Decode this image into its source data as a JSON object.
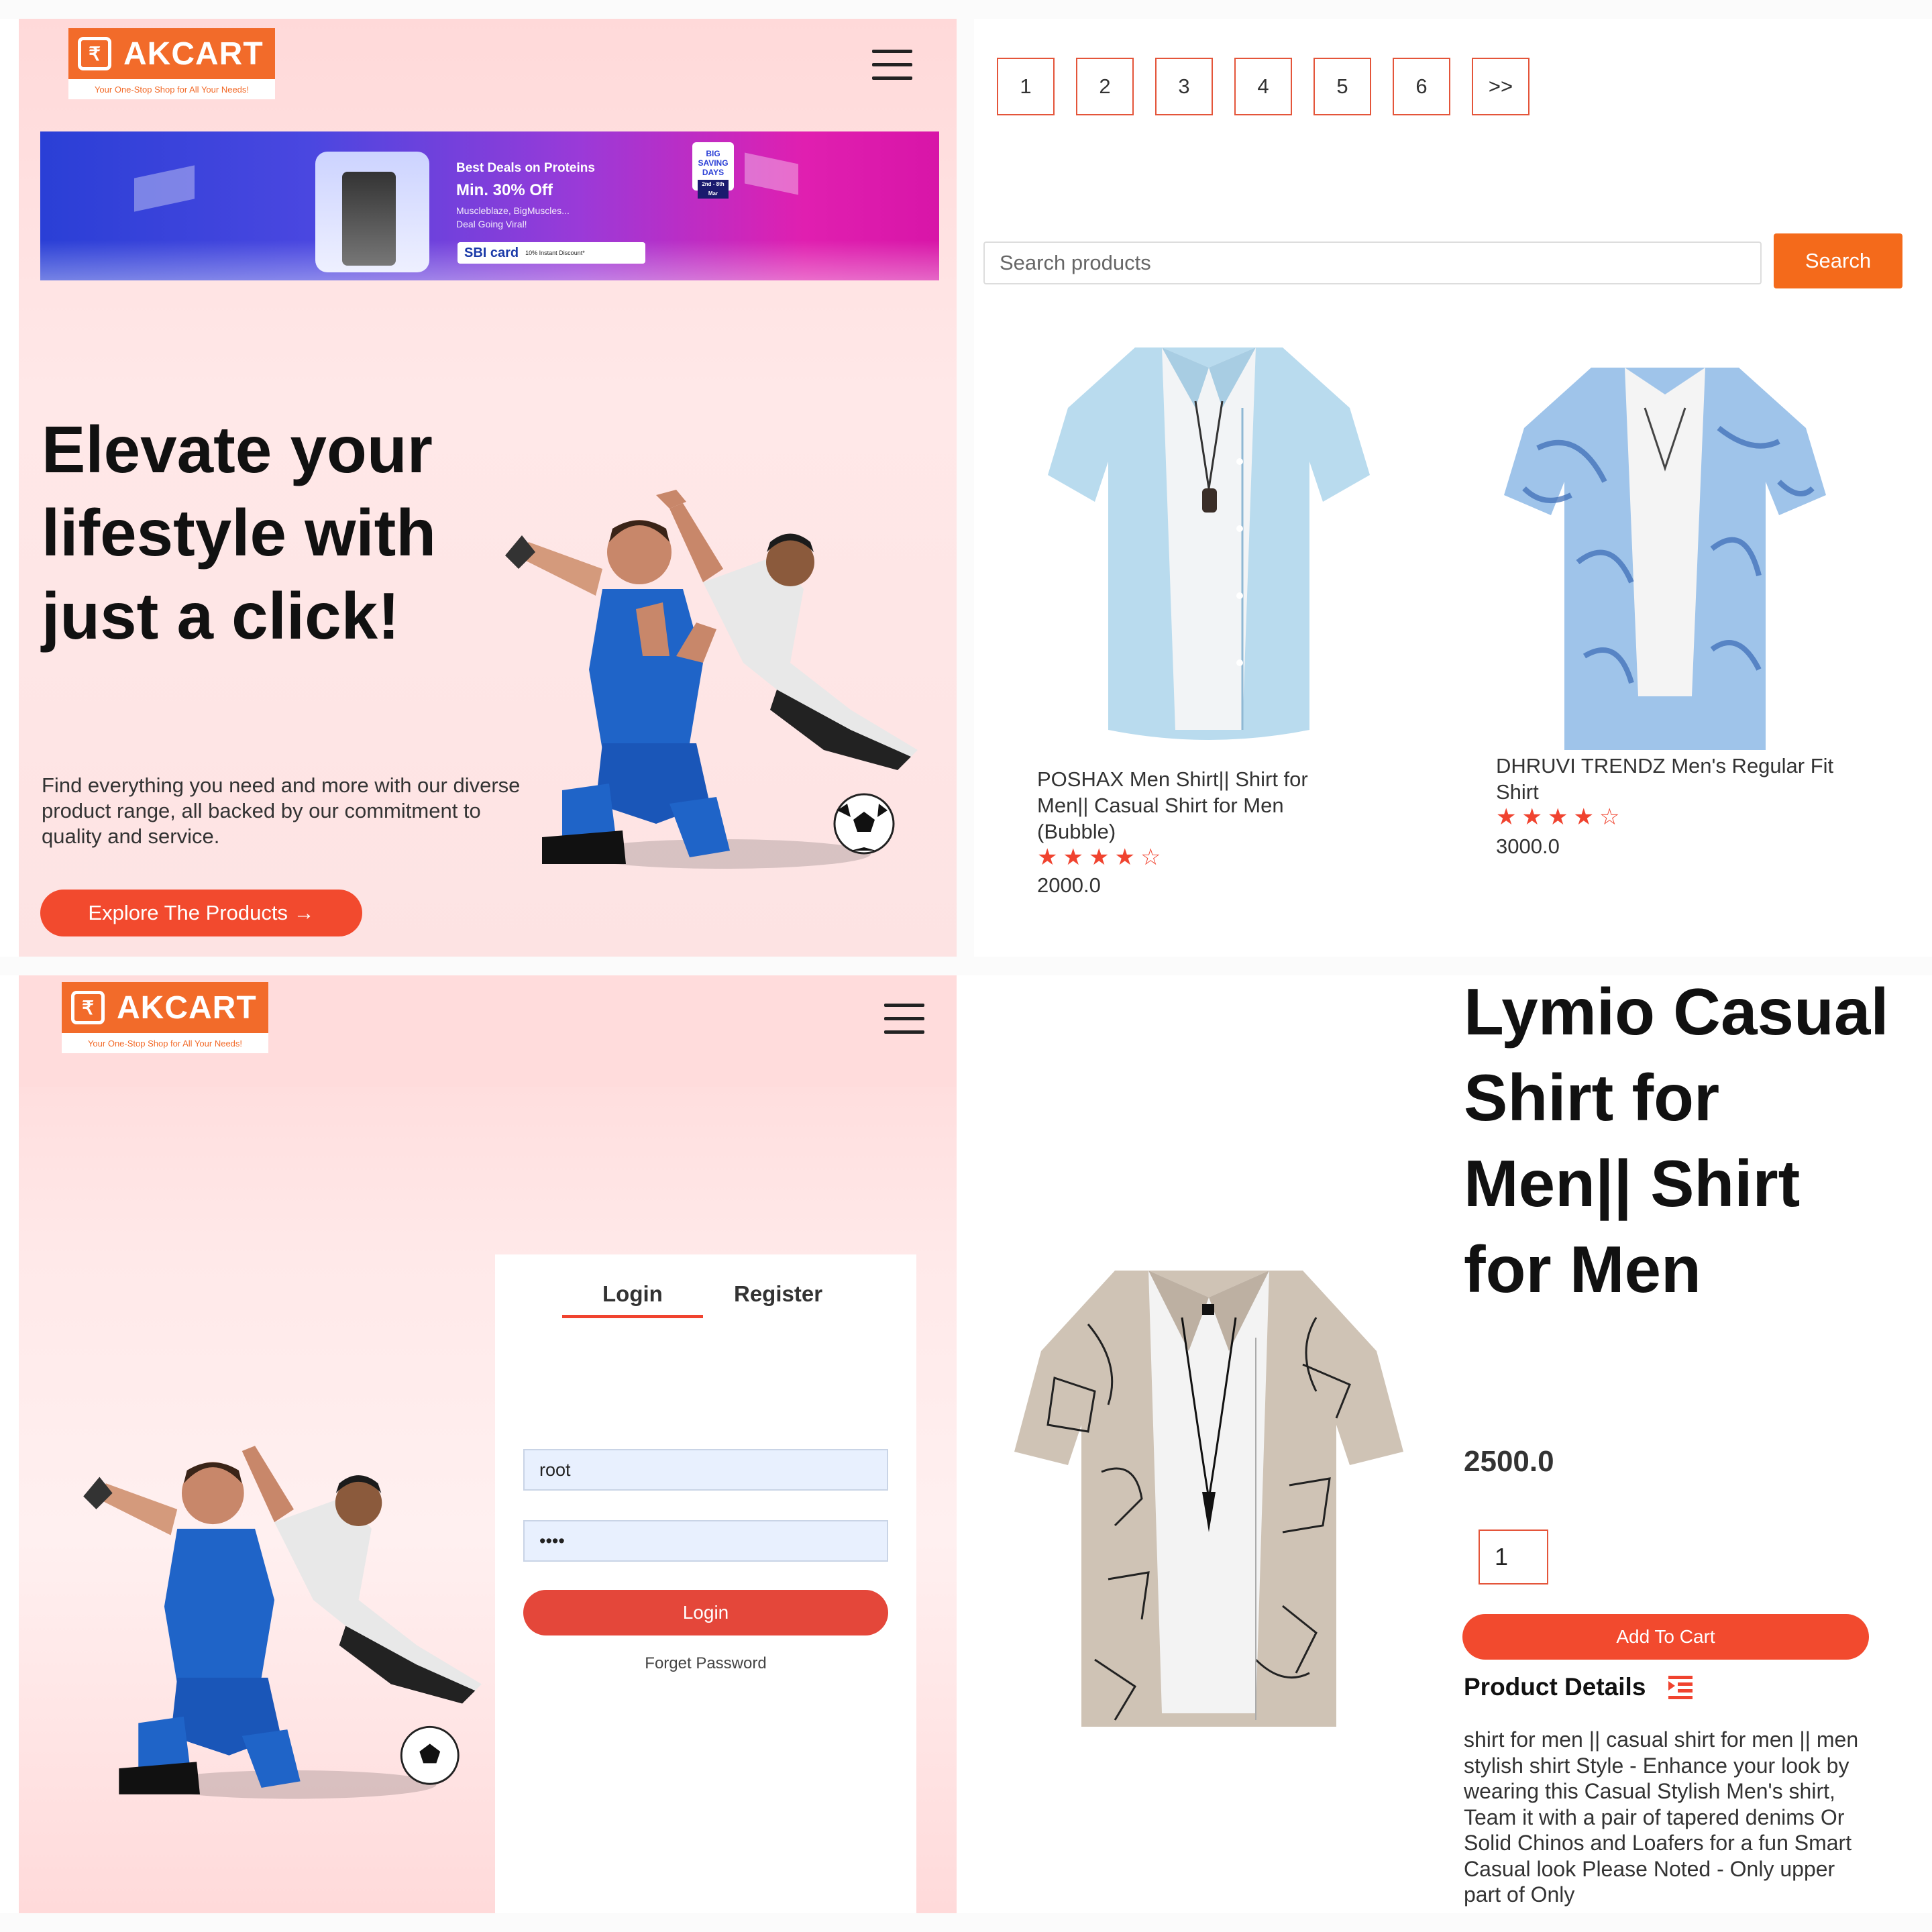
{
  "brand": {
    "name": "AKCART",
    "tagline": "Your One-Stop Shop for All Your Needs!",
    "color": "#f26b2a",
    "accent": "#f24a2e"
  },
  "home": {
    "banner": {
      "line1": "Best Deals on Proteins",
      "line2": "Min. 30% Off",
      "line3": "Muscleblaze, BigMuscles...",
      "line4": "Deal Going Viral!",
      "card_name": "SBI card",
      "card_offer": "10% Instant Discount*",
      "badge": "BIG SAVING DAYS",
      "badge_sub": "2nd - 8th Mar"
    },
    "hero_title": "Elevate your lifestyle with just a click!",
    "hero_desc": "Find everything you need and more with our diverse product range, all backed by our commitment to quality and service.",
    "cta": "Explore The Products →"
  },
  "listing": {
    "pages": [
      "1",
      "2",
      "3",
      "4",
      "5",
      "6",
      ">>"
    ],
    "search_placeholder": "Search products",
    "search_button": "Search",
    "products": [
      {
        "name": "POSHAX Men Shirt|| Shirt for Men|| Casual Shirt for Men (Bubble)",
        "rating": 4,
        "price": "2000.0",
        "stars": [
          "★",
          "★",
          "★",
          "★",
          "☆"
        ]
      },
      {
        "name": "DHRUVI TRENDZ Men's Regular Fit Shirt",
        "rating": 4,
        "price": "3000.0",
        "stars": [
          "★",
          "★",
          "★",
          "★",
          "☆"
        ]
      }
    ]
  },
  "auth": {
    "tab_login": "Login",
    "tab_register": "Register",
    "username": "root",
    "password_mask": "••••",
    "login_button": "Login",
    "forget": "Forget Password"
  },
  "detail": {
    "title": "Lymio Casual Shirt for Men|| Shirt for Men",
    "price": "2500.0",
    "quantity": "1",
    "add_to_cart": "Add To Cart",
    "details_heading": "Product Details",
    "description": "shirt for men || casual shirt for men || men stylish shirt Style - Enhance your look by wearing this Casual Stylish Men's shirt, Team it with a pair of tapered denims Or Solid Chinos and Loafers for a fun Smart Casual look Please Noted - Only upper part of Only"
  }
}
